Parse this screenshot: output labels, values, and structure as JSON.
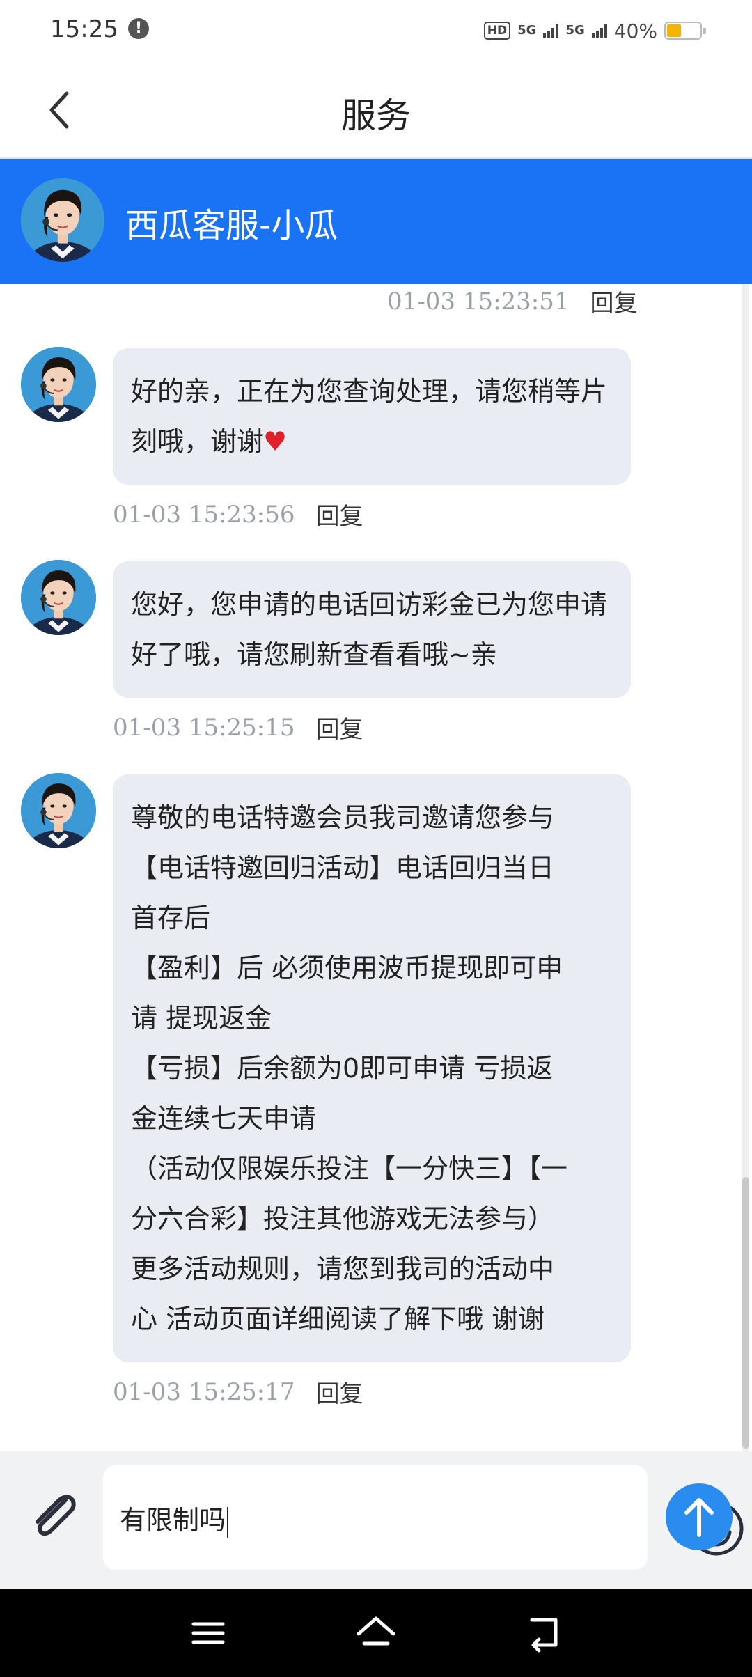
{
  "status_bar": {
    "time": "15:25",
    "alert_glyph": "!",
    "hd": "HD",
    "net_1": "5G",
    "net_2": "5G",
    "battery_text": "40%",
    "battery_level": 0.4
  },
  "nav": {
    "title": "服务",
    "back_icon": "chevron-left-icon"
  },
  "agent": {
    "name": "西瓜客服-小瓜"
  },
  "messages": [
    {
      "text": "",
      "timestamp": "01-03 15:23:51",
      "reply_label": "回复"
    },
    {
      "text": "好的亲，正在为您查询处理，请您稍等片刻哦，谢谢",
      "emoji": "♥",
      "timestamp": "01-03 15:23:56",
      "reply_label": "回复"
    },
    {
      "text": "您好，您申请的电话回访彩金已为您申请好了哦，请您刷新查看看哦~亲",
      "timestamp": "01-03 15:25:15",
      "reply_label": "回复"
    },
    {
      "lines": [
        "尊敬的电话特邀会员我司邀请您参与",
        "【电话特邀回归活动】电话回归当日",
        "首存后",
        "【盈利】后 必须使用波币提现即可申",
        "请 提现返金",
        "【亏损】后余额为0即可申请 亏损返",
        "金连续七天申请",
        "（活动仅限娱乐投注【一分快三】【一",
        "分六合彩】投注其他游戏无法参与）",
        "更多活动规则，请您到我司的活动中",
        "心 活动页面详细阅读了解下哦 谢谢"
      ],
      "timestamp": "01-03 15:25:17",
      "reply_label": "回复"
    }
  ],
  "composer": {
    "input_value": "有限制吗",
    "attach_icon": "paperclip-icon",
    "emoji_icon": "smiley-icon",
    "send_icon": "arrow-up-icon"
  },
  "system_nav": {
    "menu_icon": "menu-icon",
    "home_icon": "home-icon",
    "back_icon": "back-icon"
  },
  "colors": {
    "accent": "#1a73f5",
    "bubble": "#e9ecf2",
    "send": "#2b8cf0",
    "heart": "#e0202a"
  }
}
